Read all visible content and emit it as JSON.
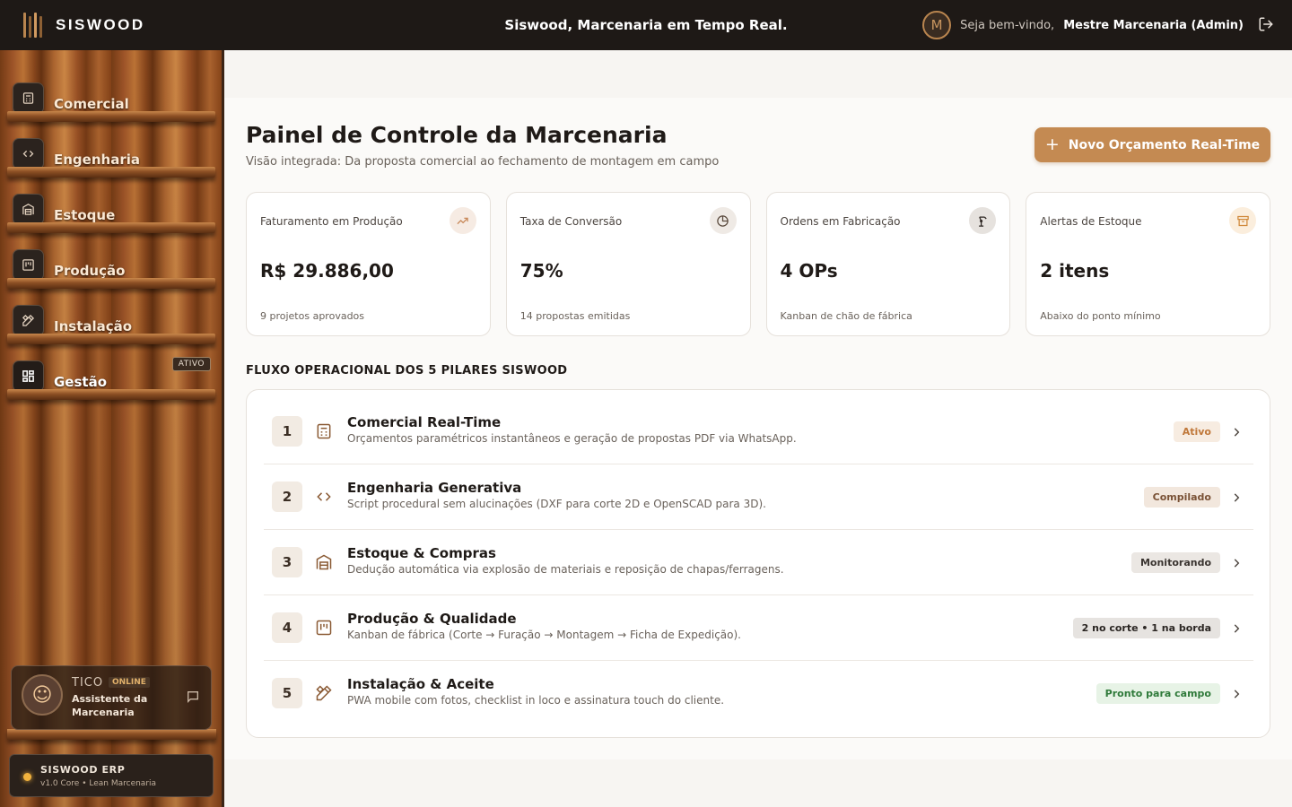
{
  "app": {
    "brand": "SISWOOD",
    "title": "Siswood, Marcenaria em Tempo Real.",
    "welcome_prefix": "Seja bem-vindo,",
    "user_name": "Mestre Marcenaria (Admin)",
    "avatar_letter": "M",
    "logout_icon": "logout-icon"
  },
  "sidebar": {
    "items": [
      {
        "label": "Comercial",
        "icon": "calculator-icon"
      },
      {
        "label": "Engenharia",
        "icon": "code-icon"
      },
      {
        "label": "Estoque",
        "icon": "warehouse-icon"
      },
      {
        "label": "Produção",
        "icon": "kanban-icon"
      },
      {
        "label": "Instalação",
        "icon": "pencil-ruler-icon"
      },
      {
        "label": "Gestão",
        "icon": "dashboard-icon"
      }
    ],
    "active_item": "Gestão",
    "active_badge": "ATIVO",
    "assistant": {
      "name": "TICO",
      "status": "ONLINE",
      "role": "Assistente da Marcenaria"
    },
    "erp": {
      "title": "SISWOOD ERP",
      "subtitle": "v1.0 Core • Lean Marcenaria"
    }
  },
  "main": {
    "title": "Painel de Controle da Marcenaria",
    "subtitle": "Visão integrada: Da proposta comercial ao fechamento de montagem em campo",
    "new_button": "Novo Orçamento Real-Time",
    "cards": [
      {
        "label": "Faturamento em Produção",
        "value": "R$ 29.886,00",
        "note": "9 projetos aprovados",
        "icon": "trending-up-icon",
        "icon_color": "#c8895a",
        "icon_bg": "#f6ebe3"
      },
      {
        "label": "Taxa de Conversão",
        "value": "75%",
        "note": "14 propostas emitidas",
        "icon": "pie-chart-icon",
        "icon_color": "#5a4a3d",
        "icon_bg": "#efeae5"
      },
      {
        "label": "Ordens em Fabricação",
        "value": "4 OPs",
        "note": "Kanban de chão de fábrica",
        "icon": "robot-arm-icon",
        "icon_color": "#2b2420",
        "icon_bg": "#e6e2de"
      },
      {
        "label": "Alertas de Estoque",
        "value": "2 itens",
        "note": "Abaixo do ponto mínimo",
        "icon": "archive-icon",
        "icon_color": "#d0893b",
        "icon_bg": "#fbeedd"
      }
    ],
    "flow_title": "FLUXO OPERACIONAL DOS 5 PILARES SISWOOD",
    "flow": [
      {
        "num": "1",
        "title": "Comercial Real-Time",
        "desc": "Orçamentos paramétricos instantâneos e geração de propostas PDF via WhatsApp.",
        "badge": "Ativo",
        "badge_color": "#c0783a",
        "badge_bg": "#f7ece1",
        "icon": "calculator-icon"
      },
      {
        "num": "2",
        "title": "Engenharia Generativa",
        "desc": "Script procedural sem alucinações (DXF para corte 2D e OpenSCAD para 3D).",
        "badge": "Compilado",
        "badge_color": "#7a5236",
        "badge_bg": "#f2e7dd",
        "icon": "code-icon"
      },
      {
        "num": "3",
        "title": "Estoque & Compras",
        "desc": "Dedução automática via explosão de materiais e reposição de chapas/ferragens.",
        "badge": "Monitorando",
        "badge_color": "#3a3430",
        "badge_bg": "#ebe7e3",
        "icon": "warehouse-icon"
      },
      {
        "num": "4",
        "title": "Produção & Qualidade",
        "desc": "Kanban de fábrica (Corte → Furação → Montagem → Ficha de Expedição).",
        "badge": "2 no corte • 1 na borda",
        "badge_color": "#2b2623",
        "badge_bg": "#e6e3e0",
        "icon": "kanban-icon"
      },
      {
        "num": "5",
        "title": "Instalação & Aceite",
        "desc": "PWA mobile com fotos, checklist in loco e assinatura touch do cliente.",
        "badge": "Pronto para campo",
        "badge_color": "#2f7a3a",
        "badge_bg": "#e7f3e6",
        "icon": "pencil-ruler-icon"
      }
    ]
  }
}
